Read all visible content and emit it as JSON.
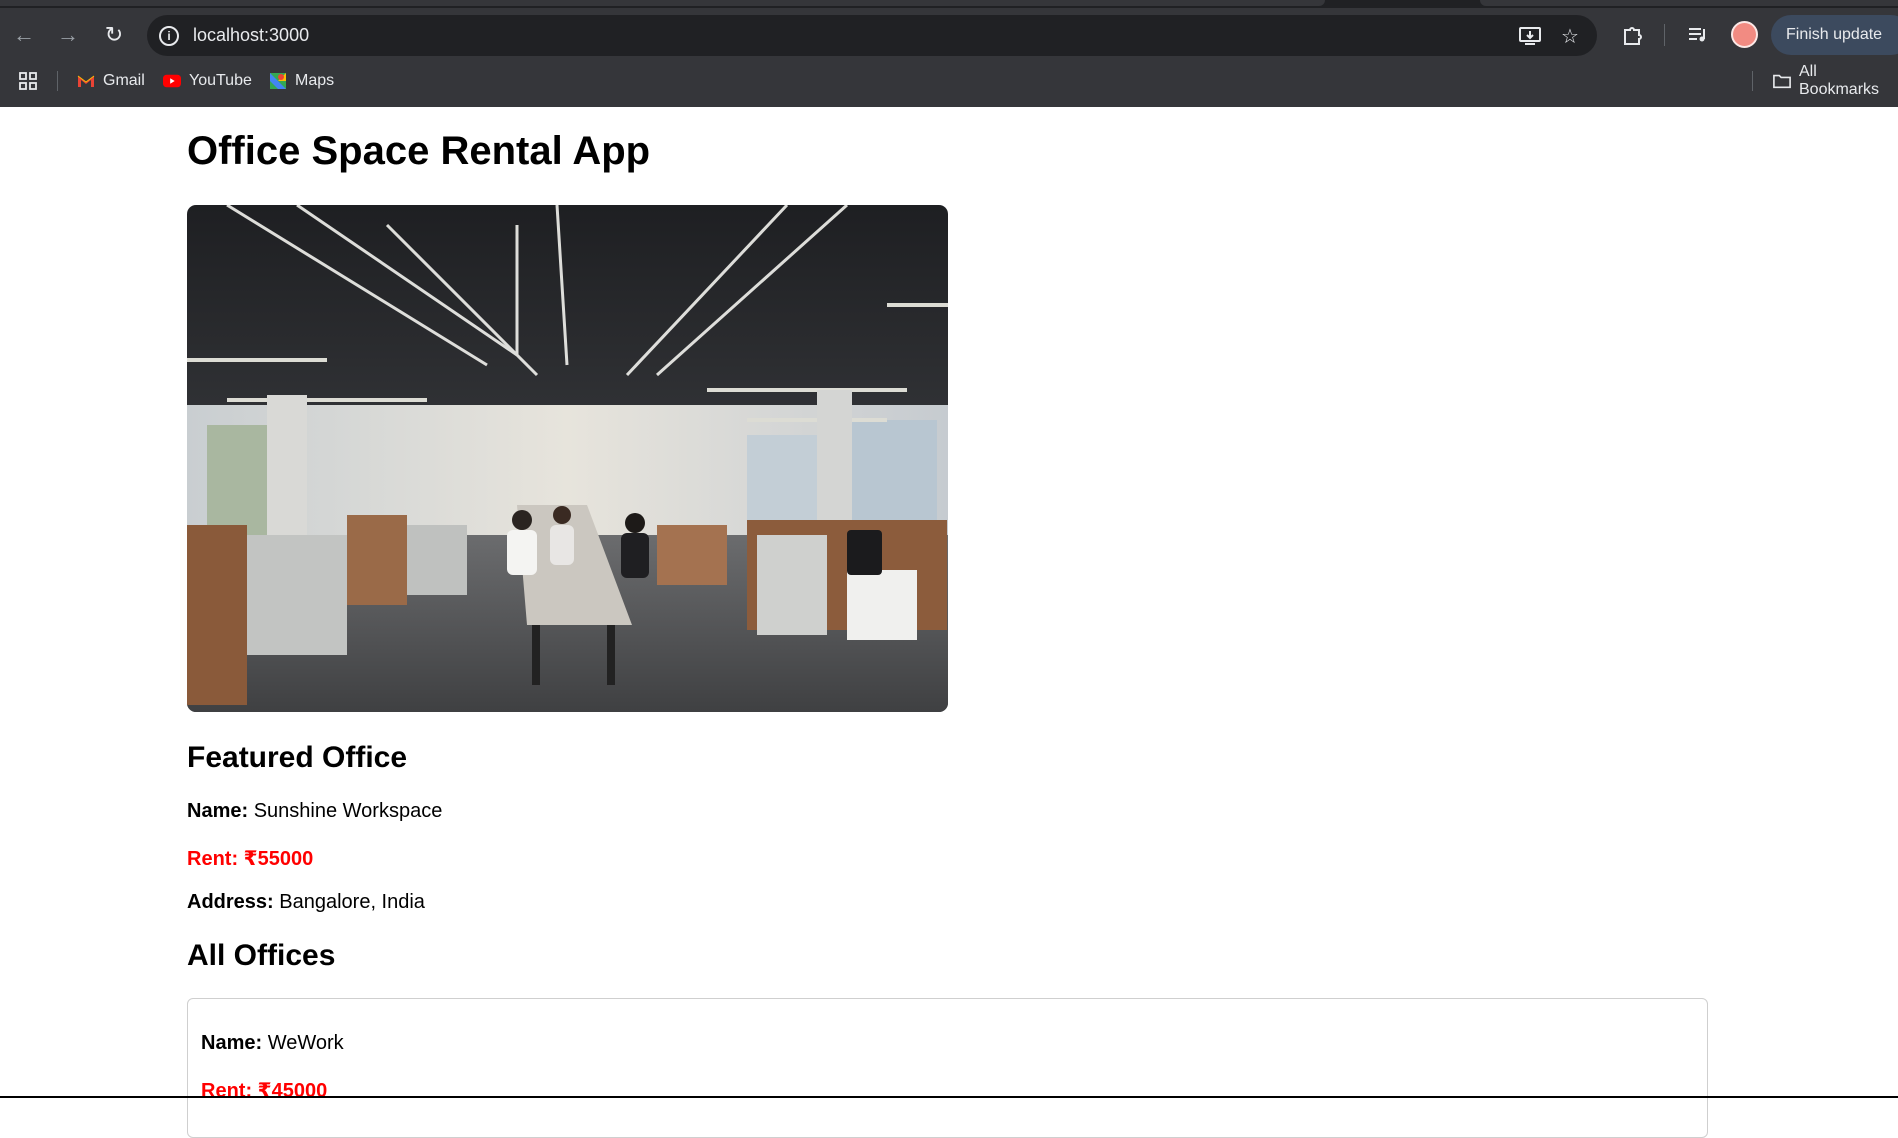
{
  "browser": {
    "url": "localhost:3000",
    "finish_update_label": "Finish update",
    "bookmarks": [
      {
        "label": "Gmail",
        "icon": "gmail-icon"
      },
      {
        "label": "YouTube",
        "icon": "youtube-icon"
      },
      {
        "label": "Maps",
        "icon": "maps-icon"
      }
    ],
    "all_bookmarks_label": "All Bookmarks"
  },
  "page": {
    "title": "Office Space Rental App",
    "hero_image": "office-interior-photo"
  },
  "featured": {
    "heading": "Featured Office",
    "name_label": "Name:",
    "name": "Sunshine Workspace",
    "rent_label": "Rent:",
    "rent": "₹55000",
    "address_label": "Address:",
    "address": "Bangalore, India"
  },
  "all_offices": {
    "heading": "All Offices",
    "items": [
      {
        "name_label": "Name:",
        "name": "WeWork",
        "rent_label": "Rent:",
        "rent": "₹45000"
      }
    ]
  },
  "colors": {
    "rent": "#ff0000",
    "chrome_bg": "#35363a",
    "omnibox_bg": "#202124"
  }
}
